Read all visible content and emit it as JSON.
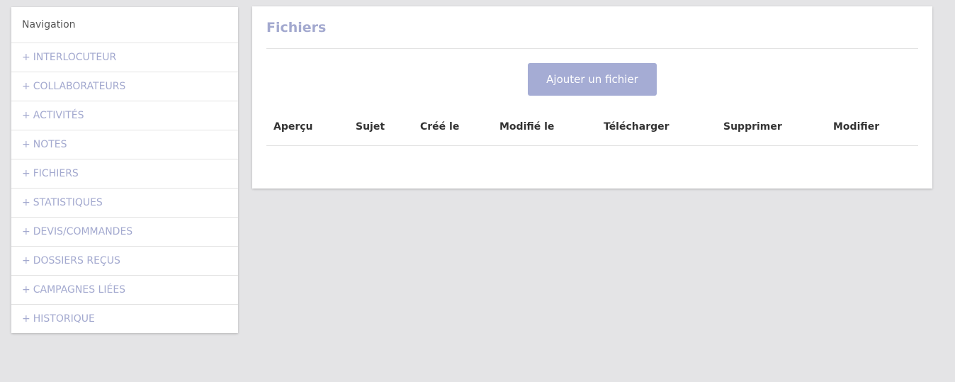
{
  "navigation": {
    "header": "Navigation",
    "items": [
      {
        "prefix": "+",
        "label": "INTERLOCUTEUR"
      },
      {
        "prefix": "+",
        "label": "COLLABORATEURS"
      },
      {
        "prefix": "+",
        "label": "ACTIVITÉS"
      },
      {
        "prefix": "+",
        "label": "NOTES"
      },
      {
        "prefix": "+",
        "label": "FICHIERS"
      },
      {
        "prefix": "+",
        "label": "STATISTIQUES"
      },
      {
        "prefix": "+",
        "label": "DEVIS/COMMANDES"
      },
      {
        "prefix": "+",
        "label": "DOSSIERS REÇUS"
      },
      {
        "prefix": "+",
        "label": "CAMPAGNES LIÉES"
      },
      {
        "prefix": "+",
        "label": "HISTORIQUE"
      }
    ]
  },
  "main": {
    "title": "Fichiers",
    "add_button_label": "Ajouter un fichier",
    "table": {
      "columns": [
        "Aperçu",
        "Sujet",
        "Créé le",
        "Modifié le",
        "Télécharger",
        "Supprimer",
        "Modifier"
      ],
      "rows": []
    }
  },
  "colors": {
    "accent": "#a3a9cf",
    "button_bg": "#a5acd4",
    "page_bg": "#e4e4e6"
  }
}
